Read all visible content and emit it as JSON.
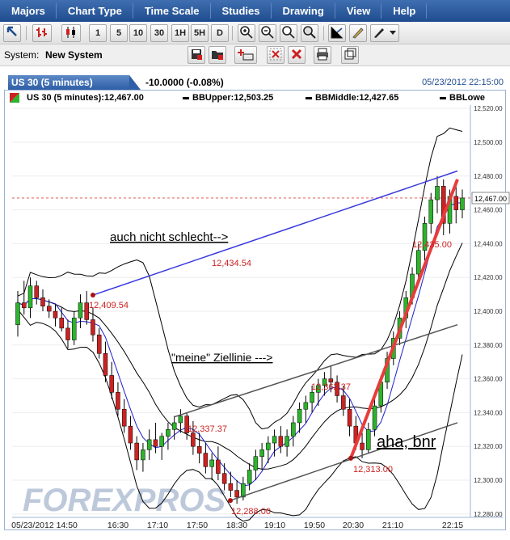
{
  "menu": [
    "Majors",
    "Chart Type",
    "Time Scale",
    "Studies",
    "Drawing",
    "View",
    "Help"
  ],
  "toolbar": {
    "period_buttons": [
      "1",
      "5",
      "10",
      "30",
      "1H",
      "5H",
      "D"
    ]
  },
  "system": {
    "label": "System:",
    "value": "New System"
  },
  "header": {
    "tab_label": "US 30 (5 minutes)",
    "change": "-10.0000 (-0.08%)",
    "datetime": "05/23/2012 22:15:00"
  },
  "legend": {
    "main": "US 30 (5 minutes):12,467.00",
    "bbupper": "BBUpper:12,503.25",
    "bbmiddle": "BBMiddle:12,427.65",
    "bblower": "BBLowe"
  },
  "watermark": "FOREXPROS",
  "colors": {
    "up": "#2db32d",
    "down": "#cc2222",
    "bb": "#000000",
    "ma": "#1f1fd0",
    "trend_blue": "#3a3ae0",
    "trend_red": "#e83c3c",
    "channel": "#555555"
  },
  "chart_data": {
    "type": "candlestick",
    "title": "US 30 (5 minutes)",
    "current_price": "12,467.00",
    "y_ticks": [
      "12,520.00",
      "12,500.00",
      "12,480.00",
      "12,460.00",
      "12,440.00",
      "12,420.00",
      "12,400.00",
      "12,380.00",
      "12,360.00",
      "12,340.00",
      "12,320.00",
      "12,300.00",
      "12,280.00"
    ],
    "ylim": [
      12278,
      12522
    ],
    "x_ticks": [
      "05/23/2012 14:50",
      "16:30",
      "17:10",
      "17:50",
      "18:30",
      "19:10",
      "19:50",
      "20:30",
      "21:10",
      "22:15"
    ],
    "candles": [
      [
        12392,
        12412,
        12385,
        12405
      ],
      [
        12405,
        12418,
        12398,
        12402
      ],
      [
        12402,
        12420,
        12396,
        12415
      ],
      [
        12415,
        12418,
        12404,
        12408
      ],
      [
        12408,
        12413,
        12400,
        12403
      ],
      [
        12403,
        12407,
        12396,
        12400
      ],
      [
        12400,
        12404,
        12391,
        12396
      ],
      [
        12396,
        12402,
        12388,
        12390
      ],
      [
        12390,
        12395,
        12378,
        12383
      ],
      [
        12383,
        12400,
        12380,
        12396
      ],
      [
        12396,
        12410,
        12390,
        12405
      ],
      [
        12405,
        12412,
        12392,
        12395
      ],
      [
        12395,
        12402,
        12382,
        12386
      ],
      [
        12386,
        12390,
        12372,
        12375
      ],
      [
        12375,
        12382,
        12358,
        12362
      ],
      [
        12362,
        12370,
        12348,
        12352
      ],
      [
        12352,
        12358,
        12338,
        12342
      ],
      [
        12342,
        12348,
        12328,
        12332
      ],
      [
        12332,
        12338,
        12318,
        12322
      ],
      [
        12322,
        12326,
        12306,
        12312
      ],
      [
        12312,
        12322,
        12305,
        12318
      ],
      [
        12318,
        12330,
        12312,
        12324
      ],
      [
        12324,
        12334,
        12316,
        12320
      ],
      [
        12320,
        12328,
        12312,
        12326
      ],
      [
        12326,
        12334,
        12318,
        12330
      ],
      [
        12330,
        12338,
        12324,
        12334
      ],
      [
        12334,
        12342,
        12328,
        12338
      ],
      [
        12338,
        12340,
        12324,
        12328
      ],
      [
        12328,
        12335,
        12315,
        12320
      ],
      [
        12320,
        12328,
        12310,
        12316
      ],
      [
        12316,
        12322,
        12304,
        12308
      ],
      [
        12308,
        12316,
        12300,
        12312
      ],
      [
        12312,
        12320,
        12300,
        12304
      ],
      [
        12304,
        12310,
        12294,
        12298
      ],
      [
        12298,
        12305,
        12290,
        12294
      ],
      [
        12294,
        12300,
        12286,
        12290
      ],
      [
        12290,
        12302,
        12288,
        12298
      ],
      [
        12298,
        12310,
        12294,
        12306
      ],
      [
        12306,
        12318,
        12300,
        12314
      ],
      [
        12314,
        12322,
        12306,
        12318
      ],
      [
        12318,
        12326,
        12310,
        12322
      ],
      [
        12322,
        12330,
        12314,
        12326
      ],
      [
        12326,
        12332,
        12316,
        12320
      ],
      [
        12320,
        12330,
        12314,
        12326
      ],
      [
        12326,
        12338,
        12320,
        12334
      ],
      [
        12334,
        12346,
        12328,
        12342
      ],
      [
        12342,
        12350,
        12334,
        12346
      ],
      [
        12346,
        12356,
        12340,
        12352
      ],
      [
        12352,
        12360,
        12344,
        12356
      ],
      [
        12356,
        12364,
        12350,
        12360
      ],
      [
        12360,
        12368,
        12352,
        12358
      ],
      [
        12358,
        12362,
        12346,
        12350
      ],
      [
        12350,
        12356,
        12338,
        12342
      ],
      [
        12342,
        12348,
        12326,
        12332
      ],
      [
        12332,
        12338,
        12318,
        12322
      ],
      [
        12322,
        12328,
        12313,
        12318
      ],
      [
        12318,
        12334,
        12316,
        12330
      ],
      [
        12330,
        12348,
        12326,
        12344
      ],
      [
        12344,
        12362,
        12340,
        12358
      ],
      [
        12358,
        12376,
        12354,
        12372
      ],
      [
        12372,
        12388,
        12368,
        12384
      ],
      [
        12384,
        12400,
        12380,
        12396
      ],
      [
        12396,
        12412,
        12390,
        12408
      ],
      [
        12408,
        12426,
        12404,
        12422
      ],
      [
        12422,
        12440,
        12418,
        12436
      ],
      [
        12436,
        12456,
        12430,
        12452
      ],
      [
        12452,
        12470,
        12446,
        12466
      ],
      [
        12466,
        12480,
        12458,
        12474
      ],
      [
        12474,
        12478,
        12445,
        12452
      ],
      [
        12452,
        12472,
        12446,
        12468
      ],
      [
        12468,
        12474,
        12452,
        12460
      ],
      [
        12460,
        12472,
        12455,
        12467
      ]
    ],
    "annotations": {
      "left_high": "12,409.54",
      "mid_blue": "12,434.54",
      "left_mid": "12,337.37",
      "mid_high": "12,362.37",
      "low": "12,288.00",
      "right_low": "12,313.00",
      "right_top": "12,435.00",
      "text1": "auch nicht schlecht-->",
      "text2": "\"meine\" Ziellinie  --->",
      "text3": "aha, bnr"
    }
  }
}
